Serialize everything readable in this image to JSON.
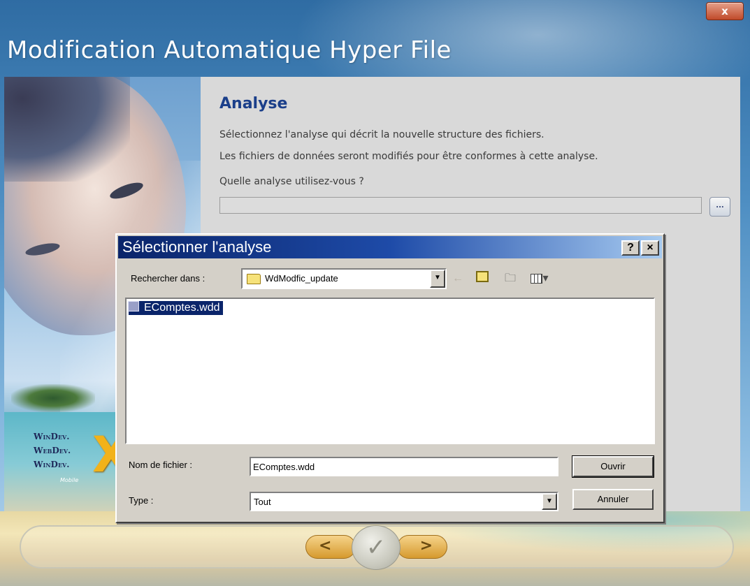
{
  "wizard": {
    "title": "Modification Automatique Hyper File",
    "close_glyph": "x",
    "heading": "Analyse",
    "description_line1": "Sélectionnez l'analyse qui décrit la nouvelle structure des fichiers.",
    "description_line2": "Les fichiers de données seront modifiés pour être conformes à cette analyse.",
    "question": "Quelle analyse utilisez-vous ?",
    "analysis_value": "",
    "browse_label": "...",
    "logos": [
      "WinDev.",
      "WebDev.",
      "WinDev."
    ],
    "logo_mobile": "Mobile",
    "nav": {
      "prev": "<",
      "finish": "✓",
      "next": ">"
    }
  },
  "dialog": {
    "title": "Sélectionner l'analyse",
    "help_label": "?",
    "close_label": "×",
    "look_in_label": "Rechercher dans :",
    "look_in_value": "WdModfic_update",
    "files": [
      {
        "name": "EComptes.wdd",
        "selected": true
      }
    ],
    "filename_label": "Nom de fichier :",
    "filename_value": "EComptes.wdd",
    "type_label": "Type :",
    "type_value": "Tout",
    "open_label": "Ouvrir",
    "cancel_label": "Annuler",
    "icons": [
      "folder-icon",
      "back-arrow-icon",
      "up-folder-icon",
      "new-folder-icon",
      "view-menu-icon",
      "analysis-file-icon"
    ]
  },
  "colors": {
    "dialog_title_start": "#0a246a",
    "dialog_title_end": "#a6caf0",
    "heading": "#1b3f8a",
    "selection": "#0a246a"
  }
}
